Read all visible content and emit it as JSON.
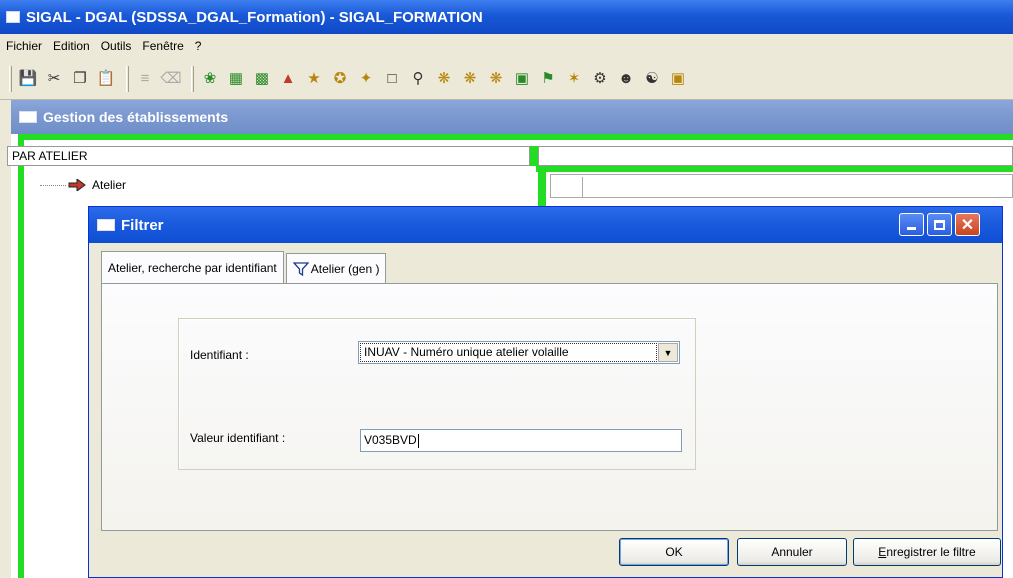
{
  "main_window": {
    "title": "SIGAL - DGAL (SDSSA_DGAL_Formation) - SIGAL_FORMATION"
  },
  "menu": [
    "Fichier",
    "Edition",
    "Outils",
    "Fenêtre",
    "?"
  ],
  "child_window": {
    "title": "Gestion des établissements",
    "grid_header": "PAR ATELIER",
    "tree_item": "Atelier"
  },
  "dialog": {
    "title": "Filtrer",
    "tabs": [
      {
        "label": "Atelier, recherche par identifiant",
        "active": true
      },
      {
        "label": "Atelier (gen )",
        "active": false,
        "icon": "filter-icon"
      }
    ],
    "identifiant_label": "Identifiant :",
    "identifiant_value": "INUAV - Numéro unique atelier volaille",
    "valeur_label": "Valeur identifiant :",
    "valeur_value": "V035BVD",
    "ok_label": "OK",
    "annuler_label": "Annuler",
    "save_label_prefix": "E",
    "save_label_rest": "nregistrer le filtre"
  },
  "colors": {
    "title_bar": "#1958d6",
    "child_title_bar": "#7b98cf",
    "highlight_green": "#22dd22",
    "dialog_bg": "#ece9d8"
  }
}
